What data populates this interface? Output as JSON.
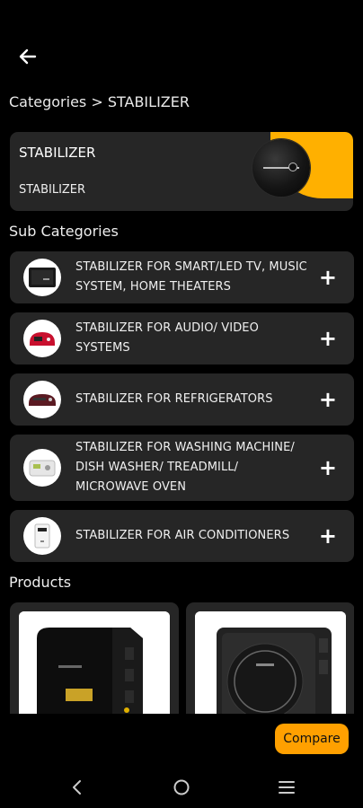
{
  "header": {
    "back_icon": "arrow-left-icon"
  },
  "breadcrumb": "Categories > STABILIZER",
  "hero": {
    "title": "STABILIZER",
    "subtitle": "STABILIZER",
    "accent_color": "#ffb000"
  },
  "sections": {
    "sub_categories": "Sub Categories",
    "products": "Products"
  },
  "sub_categories": [
    {
      "label": "STABILIZER FOR  SMART/LED TV, MUSIC SYSTEM, HOME THEATERS",
      "thumb": "black-stabilizer"
    },
    {
      "label": "STABILIZER FOR AUDIO/ VIDEO SYSTEMS",
      "thumb": "red-stabilizer"
    },
    {
      "label": "STABILIZER FOR REFRIGERATORS",
      "thumb": "maroon-stabilizer"
    },
    {
      "label": "STABILIZER FOR WASHING MACHINE/ DISH WASHER/ TREADMILL/ MICROWAVE OVEN",
      "thumb": "white-stabilizer"
    },
    {
      "label": "STABILIZER FOR AIR CONDITIONERS",
      "thumb": "white-wall-stabilizer"
    }
  ],
  "compare_label": "Compare",
  "nav": {
    "back": "nav-back-icon",
    "home": "nav-home-icon",
    "recents": "nav-menu-icon"
  }
}
